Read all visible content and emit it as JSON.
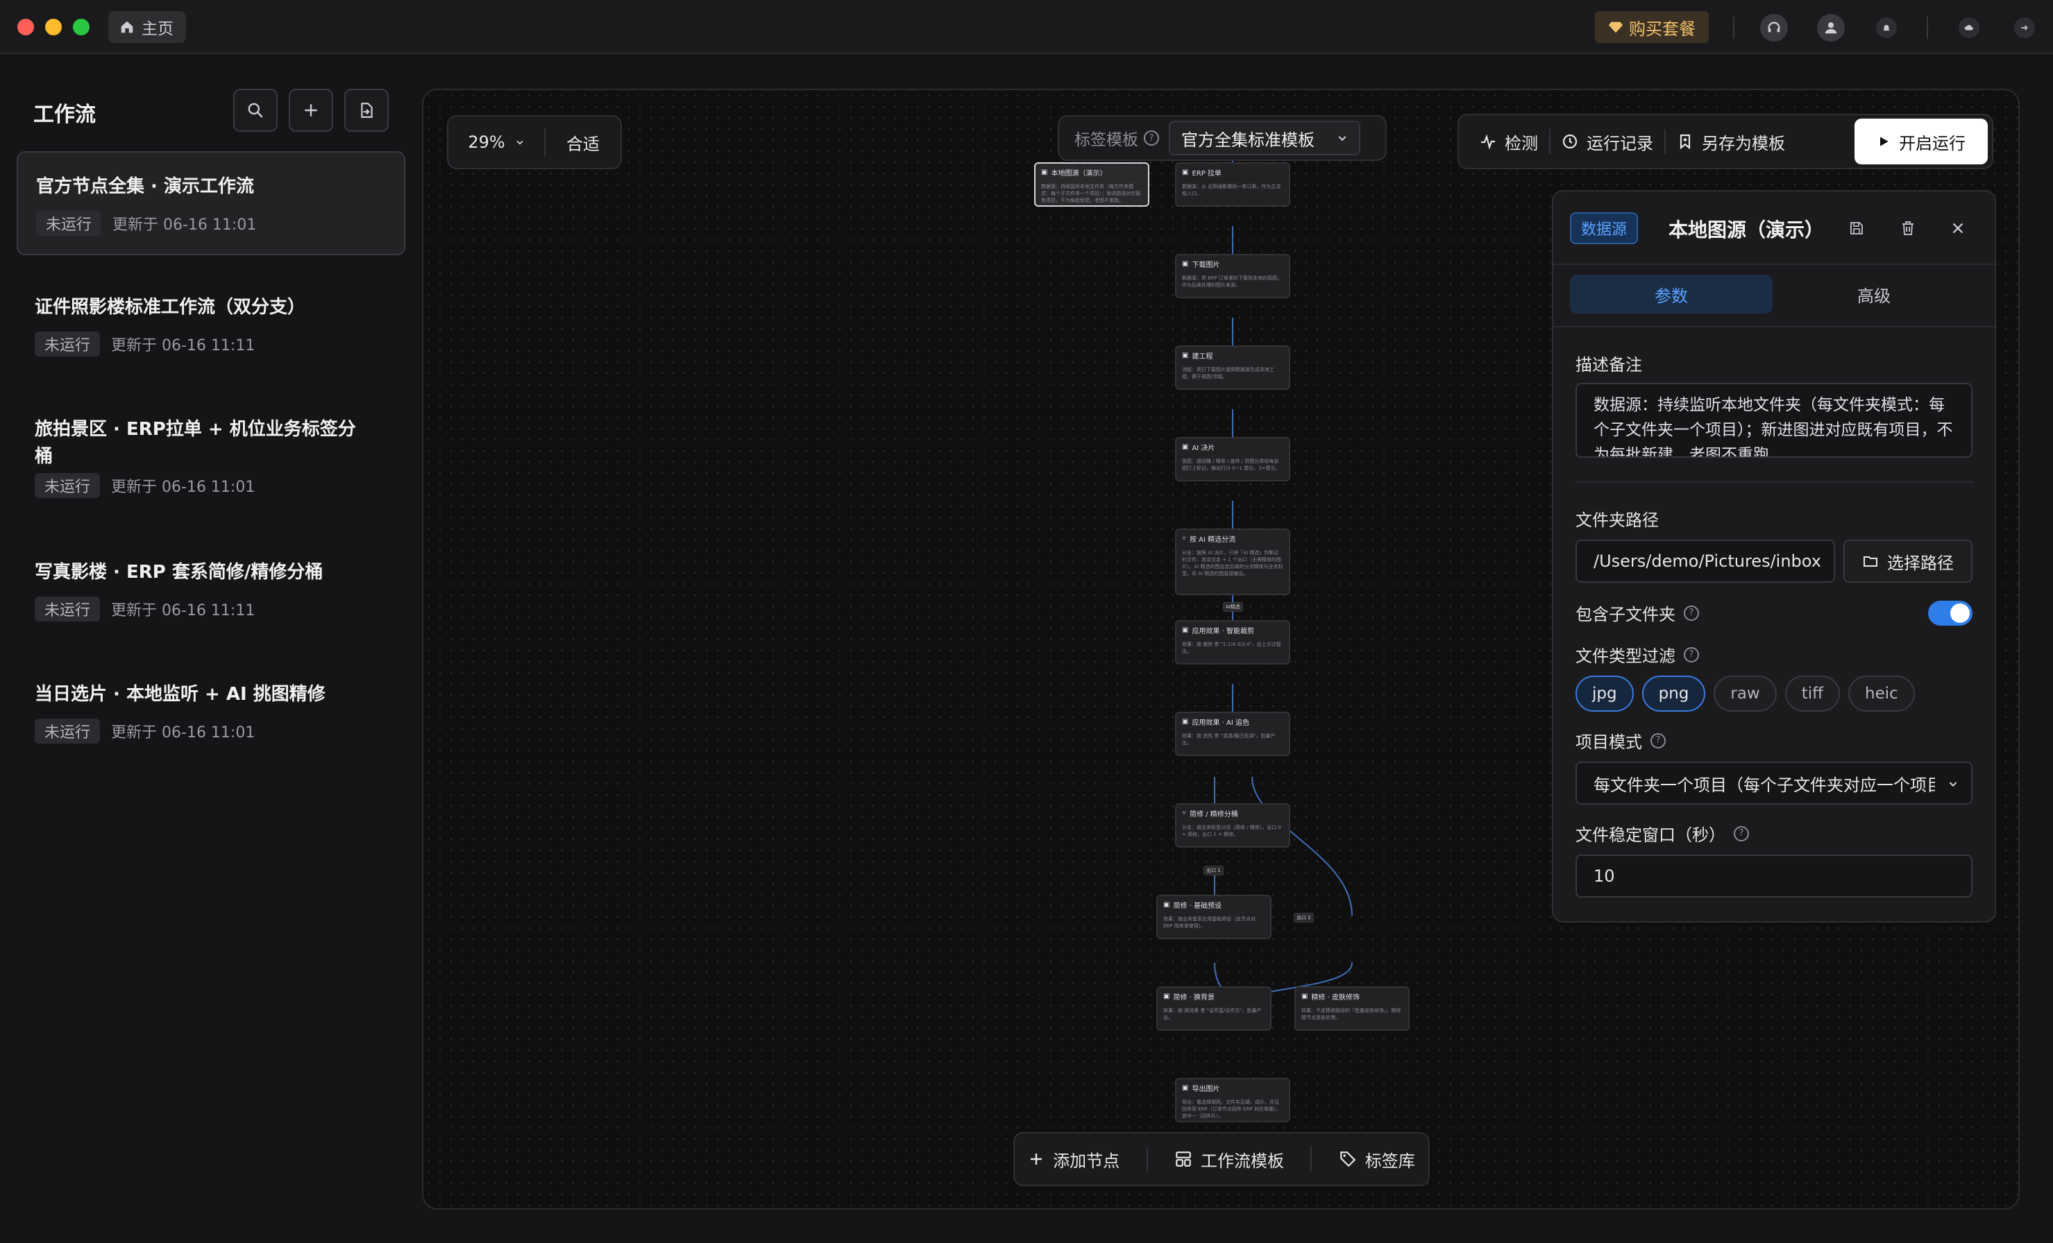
{
  "titlebar": {
    "home_tab": "主页",
    "buy_label": "购买套餐"
  },
  "sidebar": {
    "title": "工作流",
    "workflows": [
      {
        "title": "官方节点全集 · 演示工作流",
        "status": "未运行",
        "updated": "更新于 06-16 11:01"
      },
      {
        "title": "证件照影楼标准工作流（双分支）",
        "status": "未运行",
        "updated": "更新于 06-16 11:11"
      },
      {
        "title": "旅拍景区 · ERP拉单 + 机位业务标签分桶",
        "status": "未运行",
        "updated": "更新于 06-16 11:01"
      },
      {
        "title": "写真影楼 · ERP 套系简修/精修分桶",
        "status": "未运行",
        "updated": "更新于 06-16 11:11"
      },
      {
        "title": "当日选片 · 本地监听 + AI 挑图精修",
        "status": "未运行",
        "updated": "更新于 06-16 11:01"
      }
    ]
  },
  "canvas": {
    "zoom": "29%",
    "fit_label": "合适",
    "template_label": "标签模板",
    "template_value": "官方全集标准模板",
    "toolbar": {
      "check": "检测",
      "history": "运行记录",
      "save_template": "另存为模板",
      "run": "开启运行"
    },
    "nodes": [
      {
        "title": "本地图源（演示）",
        "desc": "数据源：持续监听本地文件夹（每文件夹模式：每个子文件夹一个项目）；新进图进对应既有项目，不为每批新建，老图不重跑。"
      },
      {
        "title": "ERP 拉单",
        "desc": "数据源：从 证照通影楼同一单订单，作为主流程入口。"
      },
      {
        "title": "下载图片",
        "desc": "数据源：把 ERP 订单里的下载到本地的原图，作为后续处理的图片来源。"
      },
      {
        "title": "建工程",
        "desc": "流程：把已下载图片按照数据源生成本地工程，便于挑图/流程。"
      },
      {
        "title": "AI 决片",
        "desc": "挑图：按回播 / 精修 / 废弃 / 到图分类给每张图打上标记，输出打分 0~1 建议，1=建议。"
      },
      {
        "title": "按 AI 精选分流",
        "desc": "分支：按照 AI 决片，只将「AI 精选」判断过的文件，其余交走 + 1 个出口（无需精修的图片）。AI 精选的图会走后续的分流精修与业务标签，非 AI 精选的图直接输出。"
      },
      {
        "title": "应用效果 · 智能裁剪",
        "desc": "效果：按 裁剪 参 \"1:1/4:3/3:4\"，出上方过程出。"
      },
      {
        "title": "应用效果 · AI 追色",
        "desc": "效果：按 追色 参 \"清透/暖日色调\"，批量产出。"
      },
      {
        "title": "简修 / 精修分桶",
        "desc": "分支：按业务标签分流（简修 / 精修），出口 0 = 简修，出口 1 = 精修。"
      },
      {
        "title": "简修 · 基础预设",
        "desc": "效果：按业务套系应用基础预设（此节点对 ERP 简修单使用）。"
      },
      {
        "title": "简修 · 换背景",
        "desc": "效果：按 换背景 参 \"证件蓝/证件白\"，批量产出。"
      },
      {
        "title": "精修 · 皮肤修饰",
        "desc": "效果：不走精修路径的「批量皮肤修饰」，精修按节点逐张处理。"
      },
      {
        "title": "导出图片",
        "desc": "导出：看选择规则，文件名后缀、成片、并且回传到 ERP（订单节点回传 ERP 对应单据），其中一（回传片）。"
      }
    ],
    "edge_labels": [
      "AI精选",
      "出口 1",
      "出口 2"
    ],
    "bottom": {
      "add_node": "添加节点",
      "workflow_templates": "工作流模板",
      "tag_library": "标签库"
    }
  },
  "panel": {
    "badge": "数据源",
    "title": "本地图源（演示）",
    "tabs": [
      "参数",
      "高级"
    ],
    "desc_label": "描述备注",
    "desc_value": "数据源：持续监听本地文件夹（每文件夹模式：每个子文件夹一个项目）；新进图进对应既有项目，不为每批新建，老图不重跑。",
    "folder_label": "文件夹路径",
    "folder_value": "/Users/demo/Pictures/inbox",
    "choose_path": "选择路径",
    "include_sub_label": "包含子文件夹",
    "include_sub": true,
    "filetype_label": "文件类型过滤",
    "filetypes": [
      {
        "label": "jpg",
        "on": true
      },
      {
        "label": "png",
        "on": true
      },
      {
        "label": "raw",
        "on": false
      },
      {
        "label": "tiff",
        "on": false
      },
      {
        "label": "heic",
        "on": false
      }
    ],
    "mode_label": "项目模式",
    "mode_value": "每文件夹一个项目（每个子文件夹对应一个项目）",
    "stable_label": "文件稳定窗口（秒）",
    "stable_value": "10"
  },
  "colors": {
    "accent": "#2f7de8",
    "badge_text": "#5aa2ff",
    "buy_text": "#f1c26b",
    "traffic_red": "#ff5f57",
    "traffic_yellow": "#febc2e",
    "traffic_green": "#28c840"
  }
}
